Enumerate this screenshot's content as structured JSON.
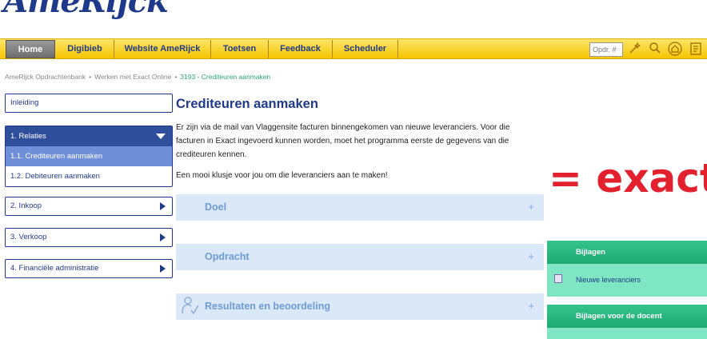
{
  "logo": {
    "text": "AmeRijck"
  },
  "nav": {
    "items": [
      "Home",
      "Digibieb",
      "Website AmeRijck",
      "Toetsen",
      "Feedback",
      "Scheduler"
    ],
    "opdr_placeholder": "Opdr. #",
    "icons": [
      "magic-wand-icon",
      "search-icon",
      "home-icon",
      "report-icon"
    ]
  },
  "breadcrumb": {
    "items": [
      "AmeRijck Opdrachtenbank",
      "Werken met Exact Online",
      "3193 - Crediteuren aanmaken"
    ],
    "separator": "•"
  },
  "sidebar": {
    "inleiding": "Inleiding",
    "relaties": {
      "label": "1. Relaties",
      "children": [
        "1.1. Crediteuren aanmaken",
        "1.2. Debiteuren aanmaken"
      ]
    },
    "items": [
      "2. Inkoop",
      "3. Verkoop",
      "4. Financiële administratie"
    ]
  },
  "main": {
    "title": "Crediteuren aanmaken",
    "intro": "Er zijn via de mail van Vlaggensite facturen binnengekomen van nieuwe leveranciers. Voor die facturen in Exact ingevoerd kunnen worden, moet het programma eerste de gegevens van die crediteuren kennen.",
    "intro2": "Een mooi klusje voor jou om die leveranciers aan te maken!",
    "sections": [
      {
        "title": "Doel",
        "icon": ""
      },
      {
        "title": "Opdracht",
        "icon": ""
      },
      {
        "title": "Resultaten en beoordeling",
        "icon": "person-check-icon"
      }
    ],
    "plus": "+"
  },
  "right": {
    "logo_text": "= exact",
    "bijlagen": {
      "title": "Bijlagen",
      "item": "Nieuwe leveranciers",
      "item_icon": "document-icon"
    },
    "bijlagen_docent": {
      "title": "Bijlagen voor de docent"
    }
  },
  "colors": {
    "nav_yellow": "#f6c500",
    "brand_blue": "#1f3a8a",
    "exact_red": "#e3202e",
    "attachment_green": "#1fa873"
  }
}
